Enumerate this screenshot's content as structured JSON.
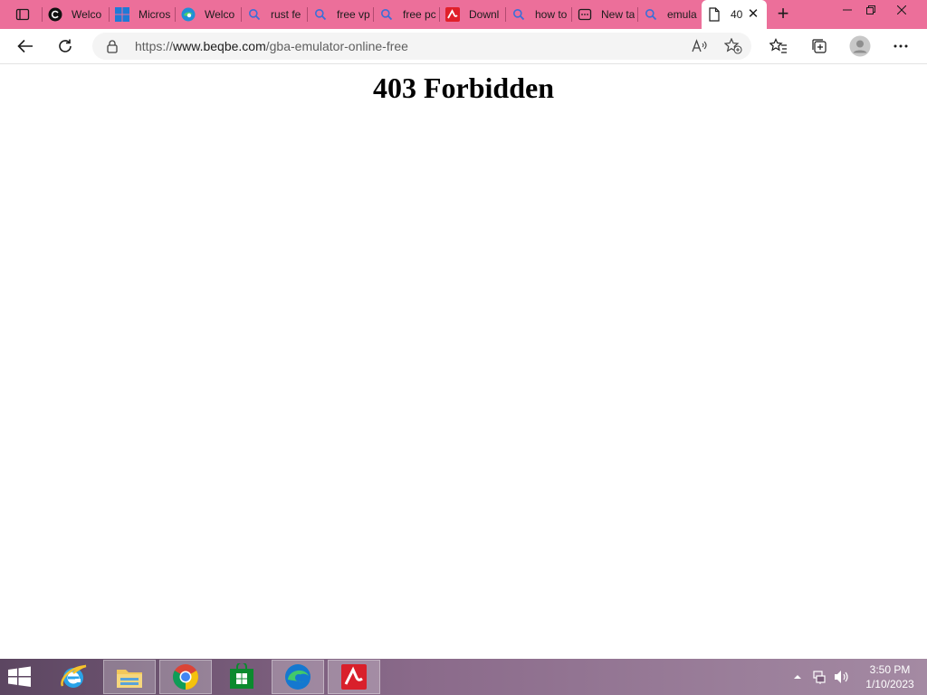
{
  "tabs": [
    {
      "title": "Welco",
      "icon": "edge-dark-icon"
    },
    {
      "title": "Micros",
      "icon": "windows-logo-icon"
    },
    {
      "title": "Welco",
      "icon": "edge-icon"
    },
    {
      "title": "rust fe",
      "icon": "search-icon"
    },
    {
      "title": "free vp",
      "icon": "search-icon"
    },
    {
      "title": "free pc",
      "icon": "search-icon"
    },
    {
      "title": "Downl",
      "icon": "avira-icon"
    },
    {
      "title": "how to",
      "icon": "search-icon"
    },
    {
      "title": "New ta",
      "icon": "new-tab-page-icon"
    },
    {
      "title": "emula",
      "icon": "search-icon"
    },
    {
      "title": "40",
      "icon": "page-icon",
      "active": true
    }
  ],
  "address_bar": {
    "url_prefix": "https://",
    "url_host": "www.beqbe.com",
    "url_path": "/gba-emulator-online-free"
  },
  "page": {
    "heading": "403 Forbidden"
  },
  "taskbar": {
    "apps": [
      "internet-explorer",
      "file-explorer",
      "chrome",
      "store",
      "edge",
      "avira"
    ],
    "clock_time": "3:50 PM",
    "clock_date": "1/10/2023"
  },
  "colors": {
    "tabstrip": "#ec6f9a",
    "taskbar": "#7a5c7a"
  }
}
